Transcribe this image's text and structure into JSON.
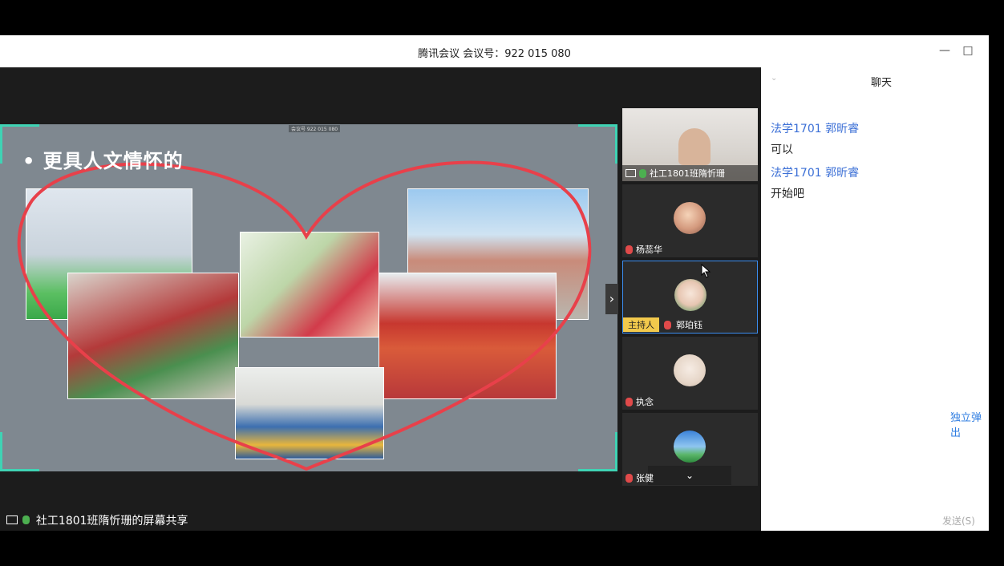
{
  "window": {
    "title": "腾讯会议 会议号：922 015 080",
    "minimize_icon": "minimize-icon",
    "maximize_icon": "maximize-icon"
  },
  "share": {
    "slide_title": "• 更具人文情怀的",
    "meeting_tag": "会议号 922 015 080",
    "label": "社工1801班隋忻珊的屏幕共享"
  },
  "participants": [
    {
      "name": "社工1801班隋忻珊",
      "mic": "on",
      "sharing": true
    },
    {
      "name": "杨蕊华",
      "mic": "muted"
    },
    {
      "name": "郭珀钰",
      "mic": "muted",
      "badge": "主持人"
    },
    {
      "name": "执念",
      "mic": "muted"
    },
    {
      "name": "张健",
      "mic": "muted"
    }
  ],
  "chat": {
    "title": "聊天",
    "messages": [
      {
        "sender": "法学1701 郭昕睿",
        "text": "可以"
      },
      {
        "sender": "法学1701 郭昕睿",
        "text": "开始吧"
      }
    ],
    "popout_label": "独立弹出",
    "send_label": "发送(S)"
  },
  "colors": {
    "accent_blue": "#3b6fd6",
    "heart_red": "#e8404a",
    "slide_bg": "#7f8890",
    "corner_teal": "#3fd3b4"
  }
}
